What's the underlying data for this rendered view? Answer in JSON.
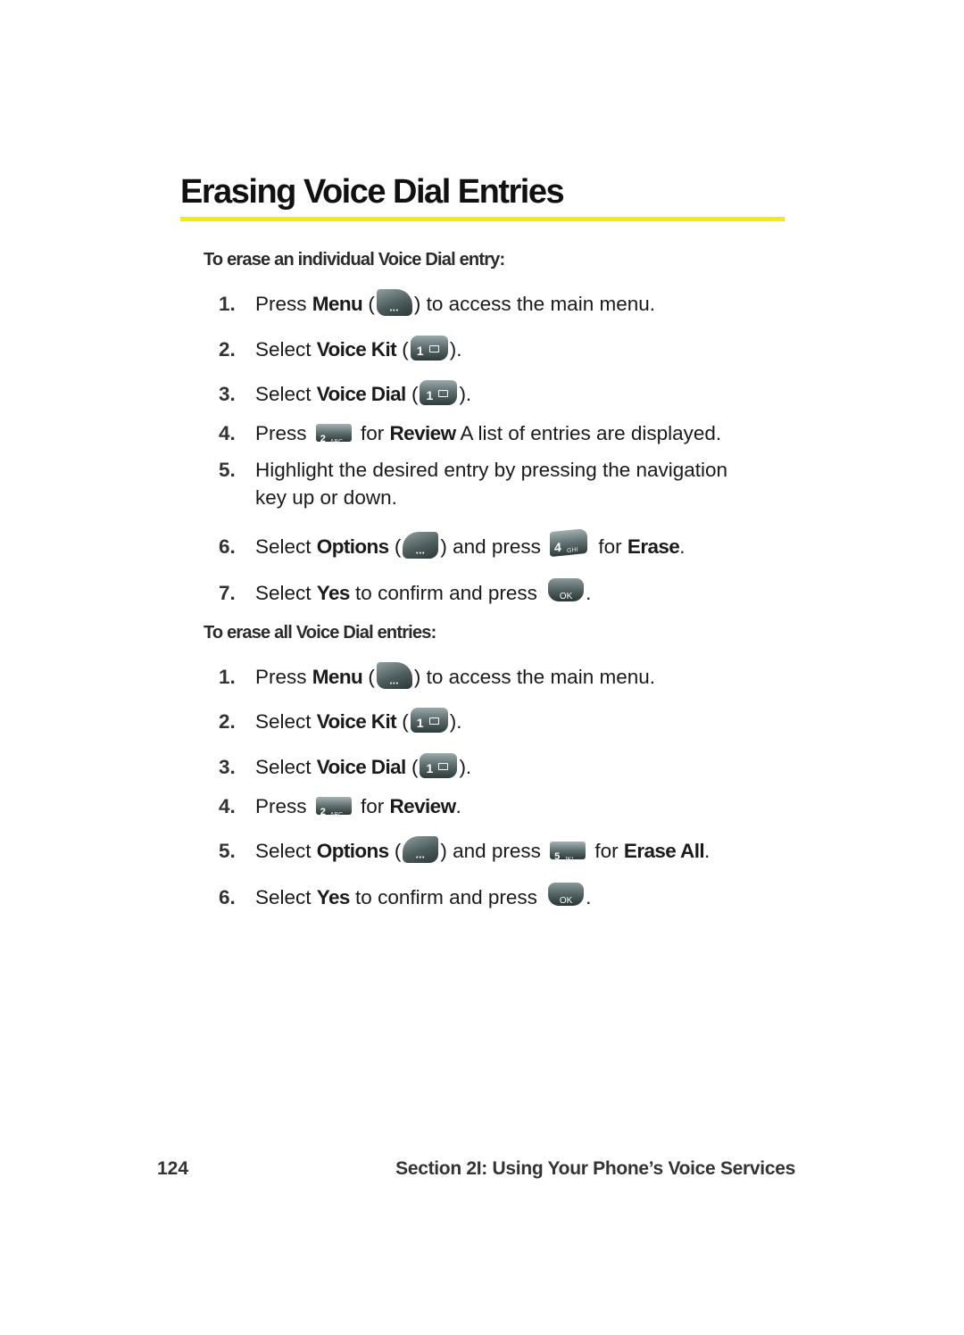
{
  "page": {
    "title": "Erasing Voice Dial Entries",
    "accent_color": "#f2ee00"
  },
  "section_individual": {
    "heading": "To erase an individual Voice Dial entry:",
    "steps": [
      {
        "num": "1.",
        "pre": "Press ",
        "bold": "Menu",
        "mid": " (",
        "key": "menu-soft-key",
        "post": ") to access the main menu."
      },
      {
        "num": "2.",
        "pre": "Select ",
        "bold": "Voice Kit",
        "mid": " (",
        "key": "1-key",
        "post": ")."
      },
      {
        "num": "3.",
        "pre": "Select ",
        "bold": "Voice Dial",
        "mid": " (",
        "key": "1-key",
        "post": ")."
      },
      {
        "num": "4.",
        "pre": "Press ",
        "key": "2abc-key",
        "mid": " for ",
        "bold": "Review",
        "post": " A list of entries are displayed."
      },
      {
        "num": "5.",
        "text": "Highlight the desired entry by pressing the navigation",
        "cont": "key up or down."
      },
      {
        "num": "6.",
        "pre": "Select ",
        "bold": "Options",
        "mid": " (",
        "key": "options-soft-key",
        "mid2": ") and press ",
        "key2": "4ghi-key",
        "mid3": " for ",
        "bold2": "Erase",
        "post": "."
      },
      {
        "num": "7.",
        "pre": "Select ",
        "bold": "Yes",
        "mid": " to confirm and press ",
        "key": "ok-key",
        "post": "."
      }
    ]
  },
  "section_all": {
    "heading": "To erase all Voice Dial entries:",
    "steps": [
      {
        "num": "1.",
        "pre": "Press ",
        "bold": "Menu",
        "mid": " (",
        "key": "menu-soft-key",
        "post": ") to access the main menu."
      },
      {
        "num": "2.",
        "pre": "Select ",
        "bold": "Voice Kit",
        "mid": " (",
        "key": "1-key",
        "post": ")."
      },
      {
        "num": "3.",
        "pre": "Select ",
        "bold": "Voice Dial",
        "mid": " (",
        "key": "1-key",
        "post": ")."
      },
      {
        "num": "4.",
        "pre": "Press ",
        "key": "2abc-key",
        "mid": " for ",
        "bold": "Review",
        "post": "."
      },
      {
        "num": "5.",
        "pre": "Select ",
        "bold": "Options",
        "mid": " (",
        "key": "options-soft-key",
        "mid2": ") and press ",
        "key2": "5jkl-key",
        "mid3": " for ",
        "bold2": "Erase All",
        "post": "."
      },
      {
        "num": "6.",
        "pre": "Select ",
        "bold": "Yes",
        "mid": " to confirm and press ",
        "key": "ok-key",
        "post": "."
      }
    ]
  },
  "keys": {
    "one": {
      "digit": "1"
    },
    "two": {
      "digit": "2",
      "letters": "ABC"
    },
    "four": {
      "digit": "4",
      "letters": "GHI"
    },
    "five": {
      "digit": "5",
      "letters": "JKL"
    },
    "ok": {
      "label": "OK"
    }
  },
  "footer": {
    "page_number": "124",
    "section": "Section 2I: Using Your Phone’s Voice Services"
  }
}
